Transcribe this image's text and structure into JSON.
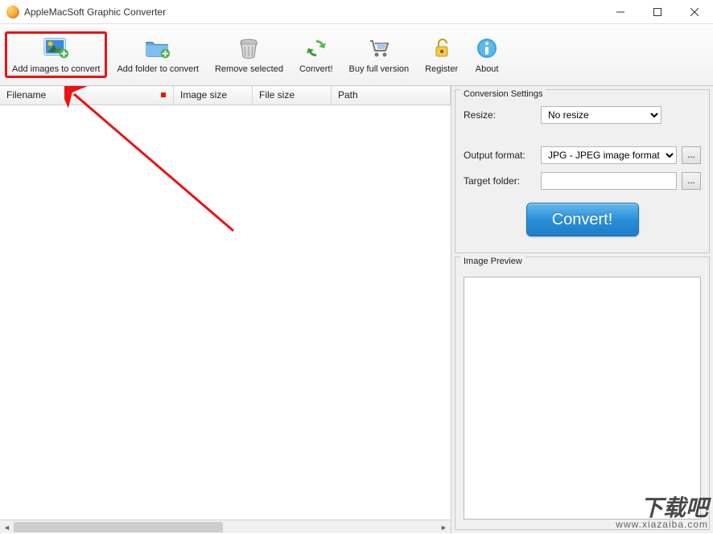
{
  "window": {
    "title": "AppleMacSoft Graphic Converter"
  },
  "toolbar": {
    "add_images": "Add images to convert",
    "add_folder": "Add folder to convert",
    "remove_selected": "Remove selected",
    "convert": "Convert!",
    "buy": "Buy full version",
    "register": "Register",
    "about": "About"
  },
  "table": {
    "headers": {
      "filename": "Filename",
      "image_size": "Image size",
      "file_size": "File size",
      "path": "Path"
    }
  },
  "settings": {
    "panel_title": "Conversion Settings",
    "resize_label": "Resize:",
    "resize_value": "No resize",
    "output_format_label": "Output format:",
    "output_format_value": "JPG - JPEG image format",
    "target_folder_label": "Target folder:",
    "target_folder_value": "",
    "ellipsis": "...",
    "convert_button": "Convert!"
  },
  "preview": {
    "panel_title": "Image Preview"
  },
  "watermark": {
    "line1": "下载吧",
    "line2": "www.xiazaiba.com"
  }
}
